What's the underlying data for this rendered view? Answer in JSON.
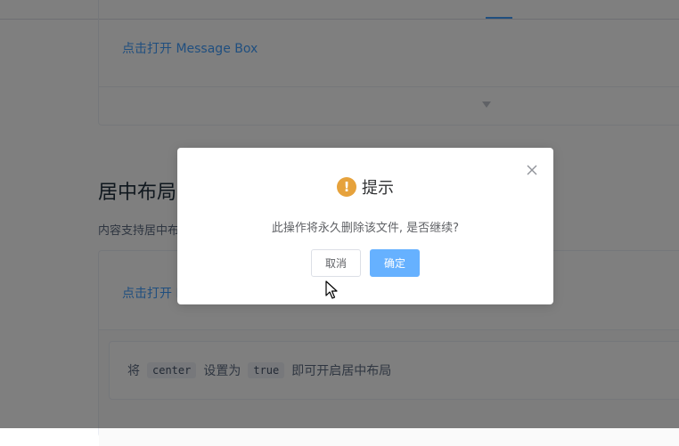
{
  "demo1": {
    "link_text": "点击打开 Message Box"
  },
  "section": {
    "title": "居中布局",
    "description": "内容支持居中布局"
  },
  "demo2": {
    "link_text": "点击打开 Message Box",
    "tip": {
      "prefix": "将",
      "code1": "center",
      "middle": "设置为",
      "code2": "true",
      "suffix": "即可开启居中布局"
    }
  },
  "dialog": {
    "title": "提示",
    "message": "此操作将永久删除该文件, 是否继续?",
    "cancel_label": "取消",
    "confirm_label": "确定",
    "warning_glyph": "!"
  },
  "colors": {
    "primary": "#409eff",
    "confirm_button": "#66b1ff",
    "warning": "#e6a23c"
  }
}
